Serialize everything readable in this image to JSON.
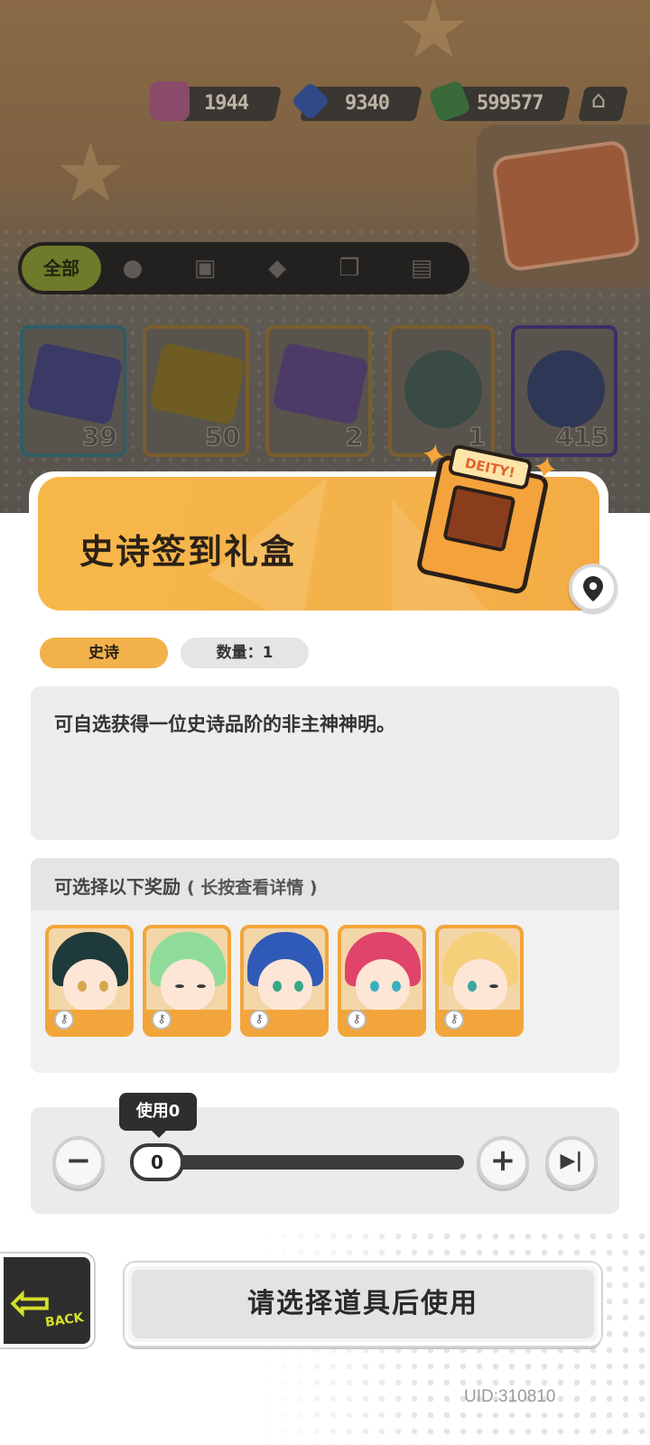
{
  "currencies": [
    {
      "icon": "potion-icon",
      "value": "1944"
    },
    {
      "icon": "diamond-icon",
      "value": "9340"
    },
    {
      "icon": "cash-icon",
      "value": "599577"
    }
  ],
  "tabs": [
    {
      "label": "全部",
      "icon": "all"
    },
    {
      "icon": "person-icon"
    },
    {
      "icon": "box-icon"
    },
    {
      "icon": "ticket-icon"
    },
    {
      "icon": "cards-icon"
    },
    {
      "icon": "book-icon"
    }
  ],
  "inventory_items": [
    {
      "icon": "purple-ticket-icon",
      "count": "39"
    },
    {
      "icon": "gold-ticket-icon",
      "count": "50"
    },
    {
      "icon": "violet-ticket-icon",
      "count": "2"
    },
    {
      "icon": "rainbow-star-icon",
      "count": "1"
    },
    {
      "icon": "blue-star-icon",
      "count": "415"
    }
  ],
  "item_detail": {
    "title": "史诗签到礼盒",
    "giftbox_label": "DEITY!",
    "rarity": "史诗",
    "quantity_label": "数量：1",
    "description": "可自选获得一位史诗品阶的非主神神明。"
  },
  "rewards": {
    "title": "可选择以下奖励",
    "hint": "( 长按查看详情 )"
  },
  "use_slider": {
    "tooltip": "使用0",
    "value": "0",
    "min_symbol": "−",
    "plus_symbol": "+",
    "max_symbol": "▶|"
  },
  "footer": {
    "back_label": "BACK",
    "use_button": "请选择道具后使用",
    "uid": "UID:310810"
  },
  "colors": {
    "accent_orange": "#f2b14a",
    "avatar_border": "#f2a53a",
    "back_accent": "#d6e02a"
  }
}
